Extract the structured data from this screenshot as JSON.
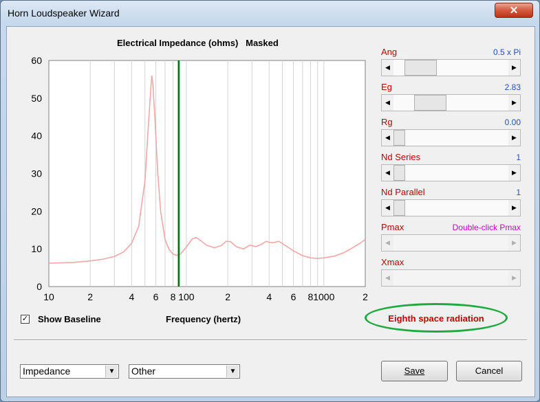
{
  "window": {
    "title": "Horn Loudspeaker Wizard",
    "close_glyph": "✕"
  },
  "chart_title": "Electrical Impedance (ohms)   Masked",
  "chart_data": {
    "type": "line",
    "title": "Electrical Impedance (ohms)   Masked",
    "xlabel": "Frequency (hertz)",
    "ylabel": "",
    "x_scale": "log",
    "xlim": [
      10,
      2000
    ],
    "ylim": [
      0,
      60
    ],
    "y_ticks": [
      0,
      10,
      20,
      30,
      40,
      50,
      60
    ],
    "x_tick_labels": [
      {
        "value": 10,
        "label": "10"
      },
      {
        "value": 20,
        "label": "2"
      },
      {
        "value": 40,
        "label": "4"
      },
      {
        "value": 60,
        "label": "6"
      },
      {
        "value": 80,
        "label": "8"
      },
      {
        "value": 100,
        "label": "100"
      },
      {
        "value": 200,
        "label": "2"
      },
      {
        "value": 400,
        "label": "4"
      },
      {
        "value": 600,
        "label": "6"
      },
      {
        "value": 800,
        "label": "8"
      },
      {
        "value": 1000,
        "label": "1000"
      },
      {
        "value": 2000,
        "label": "2"
      }
    ],
    "grid": true,
    "marker_x": 88,
    "series": [
      {
        "color": "#f4a6a6",
        "points": [
          [
            10,
            6.2
          ],
          [
            15,
            6.4
          ],
          [
            20,
            6.8
          ],
          [
            25,
            7.3
          ],
          [
            30,
            8.0
          ],
          [
            35,
            9.2
          ],
          [
            40,
            11.5
          ],
          [
            45,
            16
          ],
          [
            50,
            28
          ],
          [
            53,
            43
          ],
          [
            55,
            52
          ],
          [
            56,
            56
          ],
          [
            57,
            54
          ],
          [
            59,
            45
          ],
          [
            62,
            30
          ],
          [
            65,
            20
          ],
          [
            70,
            12.5
          ],
          [
            75,
            9.8
          ],
          [
            80,
            8.6
          ],
          [
            85,
            8.3
          ],
          [
            90,
            8.5
          ],
          [
            100,
            10.5
          ],
          [
            110,
            12.6
          ],
          [
            118,
            13
          ],
          [
            125,
            12.4
          ],
          [
            140,
            11.0
          ],
          [
            160,
            10.3
          ],
          [
            180,
            10.9
          ],
          [
            195,
            12
          ],
          [
            210,
            11.9
          ],
          [
            230,
            10.6
          ],
          [
            260,
            10
          ],
          [
            290,
            11
          ],
          [
            320,
            10.6
          ],
          [
            350,
            11.2
          ],
          [
            380,
            12
          ],
          [
            420,
            11.6
          ],
          [
            470,
            12
          ],
          [
            520,
            11
          ],
          [
            600,
            9.5
          ],
          [
            700,
            8.2
          ],
          [
            800,
            7.6
          ],
          [
            900,
            7.5
          ],
          [
            1000,
            7.6
          ],
          [
            1200,
            8.1
          ],
          [
            1400,
            9.0
          ],
          [
            1600,
            10.2
          ],
          [
            1800,
            11.3
          ],
          [
            2000,
            12.5
          ]
        ]
      }
    ]
  },
  "controls": [
    {
      "label": "Ang",
      "value": "0.5 x Pi",
      "fraction": 0.13,
      "enabled": true
    },
    {
      "label": "Eg",
      "value": "2.83",
      "fraction": 0.25,
      "enabled": true
    },
    {
      "label": "Rg",
      "value": "0.00",
      "fraction": 0.0,
      "enabled": true
    },
    {
      "label": "Nd  Series",
      "value": "1",
      "fraction": 0.0,
      "enabled": true
    },
    {
      "label": "Nd  Parallel",
      "value": "1",
      "fraction": 0.0,
      "enabled": true
    },
    {
      "label": "Pmax",
      "value": "Double-click Pmax",
      "fraction": null,
      "enabled": false
    },
    {
      "label": "Xmax",
      "value": "",
      "fraction": null,
      "enabled": false
    }
  ],
  "colors": {
    "control_label": "#c00000",
    "control_value": "#2050c0",
    "pmax_hint": "#cc00cc",
    "marker": "#007000",
    "curve": "#f4a6a6",
    "highlight": "#1faa40"
  },
  "show_baseline": {
    "label": "Show Baseline",
    "checked": true,
    "check_glyph": "✓"
  },
  "frequency_label": "Frequency (hertz)",
  "radiation": "Eighth space radiation",
  "combo_left": {
    "value": "Impedance",
    "arrow_glyph": "▼"
  },
  "combo_right": {
    "value": "Other",
    "arrow_glyph": "▼"
  },
  "buttons": {
    "save": "Save",
    "cancel": "Cancel"
  },
  "scroll_glyphs": {
    "left": "◀",
    "right": "▶"
  }
}
